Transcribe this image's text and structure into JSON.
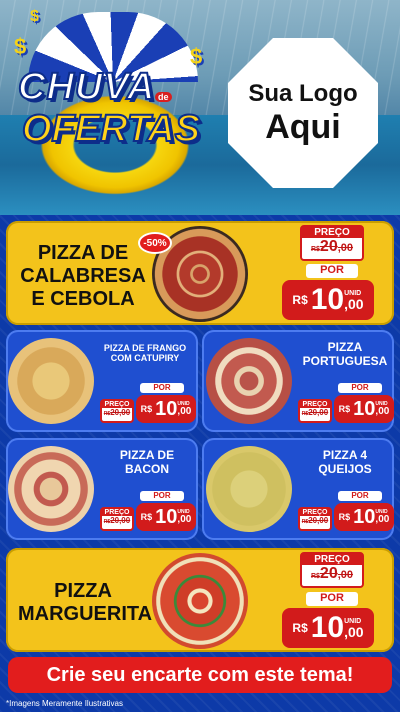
{
  "header": {
    "title_line1": "CHUVA",
    "title_de": "de",
    "title_line2": "OFERTAS",
    "logo_line1": "Sua Logo",
    "logo_line2": "Aqui"
  },
  "products": [
    {
      "name": "PIZZA DE CALABRESA E CEBOLA",
      "name_lines": [
        "PIZZA DE",
        "CALABRESA",
        "E CEBOLA"
      ],
      "discount": "-50%",
      "price_label": "PREÇO",
      "old_price_currency": "R$",
      "old_price_int": "20",
      "old_price_cents": ",00",
      "por_label": "POR",
      "new_price_currency": "R$",
      "new_price_int": "10",
      "new_price_cents": ",00",
      "unit": "UNID",
      "image": "pizza-calabresa"
    },
    {
      "name_lines": [
        "PIZZA DE FRANGO",
        "COM CATUPIRY"
      ],
      "por_label": "POR",
      "price_label": "PREÇO",
      "old_price_currency": "R$",
      "old_price": "20,00",
      "new_price_currency": "R$",
      "new_price_int": "10",
      "new_price_cents": ",00",
      "unit": "UNID",
      "image": "pizza-frango"
    },
    {
      "name_lines": [
        "PIZZA",
        "PORTUGUESA"
      ],
      "por_label": "POR",
      "price_label": "PREÇO",
      "old_price_currency": "R$",
      "old_price": "20,00",
      "new_price_currency": "R$",
      "new_price_int": "10",
      "new_price_cents": ",00",
      "unit": "UNID",
      "image": "pizza-portuguesa"
    },
    {
      "name_lines": [
        "PIZZA DE",
        "BACON"
      ],
      "por_label": "POR",
      "price_label": "PREÇO",
      "old_price_currency": "R$",
      "old_price": "20,00",
      "new_price_currency": "R$",
      "new_price_int": "10",
      "new_price_cents": ",00",
      "unit": "UNID",
      "image": "pizza-bacon"
    },
    {
      "name_lines": [
        "PIZZA 4",
        "QUEIJOS"
      ],
      "por_label": "POR",
      "price_label": "PREÇO",
      "old_price_currency": "R$",
      "old_price": "20,00",
      "new_price_currency": "R$",
      "new_price_int": "10",
      "new_price_cents": ",00",
      "unit": "UNID",
      "image": "pizza-4-queijos"
    },
    {
      "name_lines": [
        "PIZZA",
        "MARGUERITA"
      ],
      "price_label": "PREÇO",
      "old_price_currency": "R$",
      "old_price_int": "20",
      "old_price_cents": ",00",
      "por_label": "POR",
      "new_price_currency": "R$",
      "new_price_int": "10",
      "new_price_cents": ",00",
      "unit": "UNID",
      "image": "pizza-marguerita"
    }
  ],
  "cta": "Crie seu encarte com este tema!",
  "footnote": "*Imagens Meramente Ilustrativas",
  "colors": {
    "brand_blue": "#0d3aa8",
    "card_yellow": "#f3c31b",
    "price_red": "#d21b1b"
  }
}
